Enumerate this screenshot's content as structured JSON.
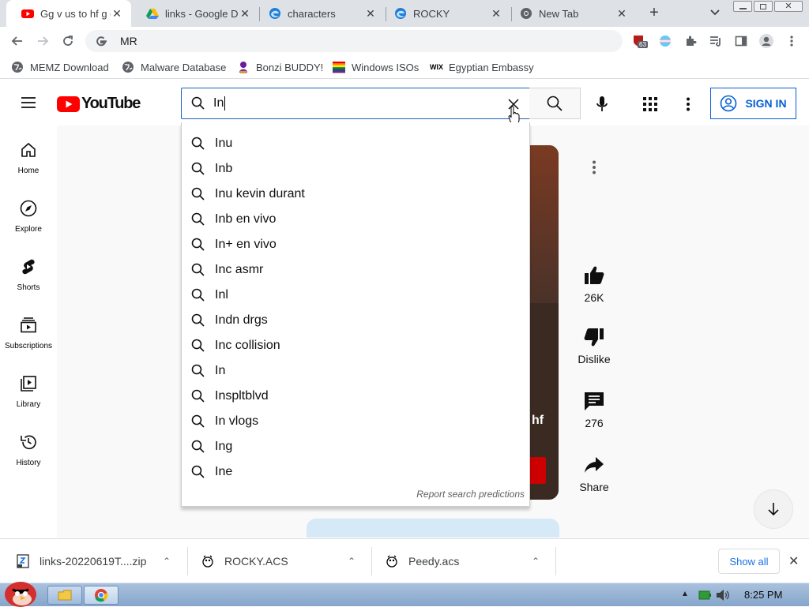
{
  "tabs": [
    {
      "title": "Gg v us to hf g g",
      "active": true,
      "icon": "youtube-icon"
    },
    {
      "title": "links - Google D",
      "active": false,
      "icon": "google-drive-icon"
    },
    {
      "title": "characters",
      "active": false,
      "icon": "edge-icon"
    },
    {
      "title": "ROCKY",
      "active": false,
      "icon": "edge-icon"
    },
    {
      "title": "New Tab",
      "active": false,
      "icon": "chrome-icon"
    }
  ],
  "toolbar": {
    "url": "MR",
    "extension_badge": "63"
  },
  "bookmarks": [
    {
      "label": "MEMZ Download",
      "icon": "globe-icon"
    },
    {
      "label": "Malware Database",
      "icon": "globe-icon"
    },
    {
      "label": "Bonzi BUDDY!",
      "icon": "bonzi-icon"
    },
    {
      "label": "Windows ISOs",
      "icon": "windows-flag-icon"
    },
    {
      "label": "Egyptian Embassy",
      "icon": "wix-icon"
    }
  ],
  "youtube": {
    "logo_text": "YouTube",
    "search_query": "In",
    "signin_label": "SIGN IN",
    "guide": [
      {
        "label": "Home",
        "icon": "home-icon"
      },
      {
        "label": "Explore",
        "icon": "compass-icon"
      },
      {
        "label": "Shorts",
        "icon": "shorts-icon"
      },
      {
        "label": "Subscriptions",
        "icon": "subscriptions-icon"
      },
      {
        "label": "Library",
        "icon": "library-icon"
      },
      {
        "label": "History",
        "icon": "history-icon"
      }
    ],
    "suggestions": [
      "Inu",
      "Inb",
      "Inu kevin durant",
      "Inb en vivo",
      "In+ en vivo",
      "Inc asmr",
      "Inl",
      "Indn drgs",
      "Inc collision",
      "In",
      "Inspltblvd",
      "In vlogs",
      "Ing",
      "Ine"
    ],
    "report_label": "Report search predictions",
    "actions": {
      "likes": "26K",
      "dislike_label": "Dislike",
      "comments": "276",
      "share_label": "Share"
    },
    "video_overlay_text": "hf"
  },
  "downloads": {
    "items": [
      "links-20220619T....zip",
      "ROCKY.ACS",
      "Peedy.acs"
    ],
    "show_all": "Show all"
  },
  "taskbar": {
    "clock": "8:25 PM"
  },
  "colors": {
    "youtube_red": "#ff0000",
    "accent_blue": "#065fd4",
    "tabstrip": "#dee1e6"
  }
}
